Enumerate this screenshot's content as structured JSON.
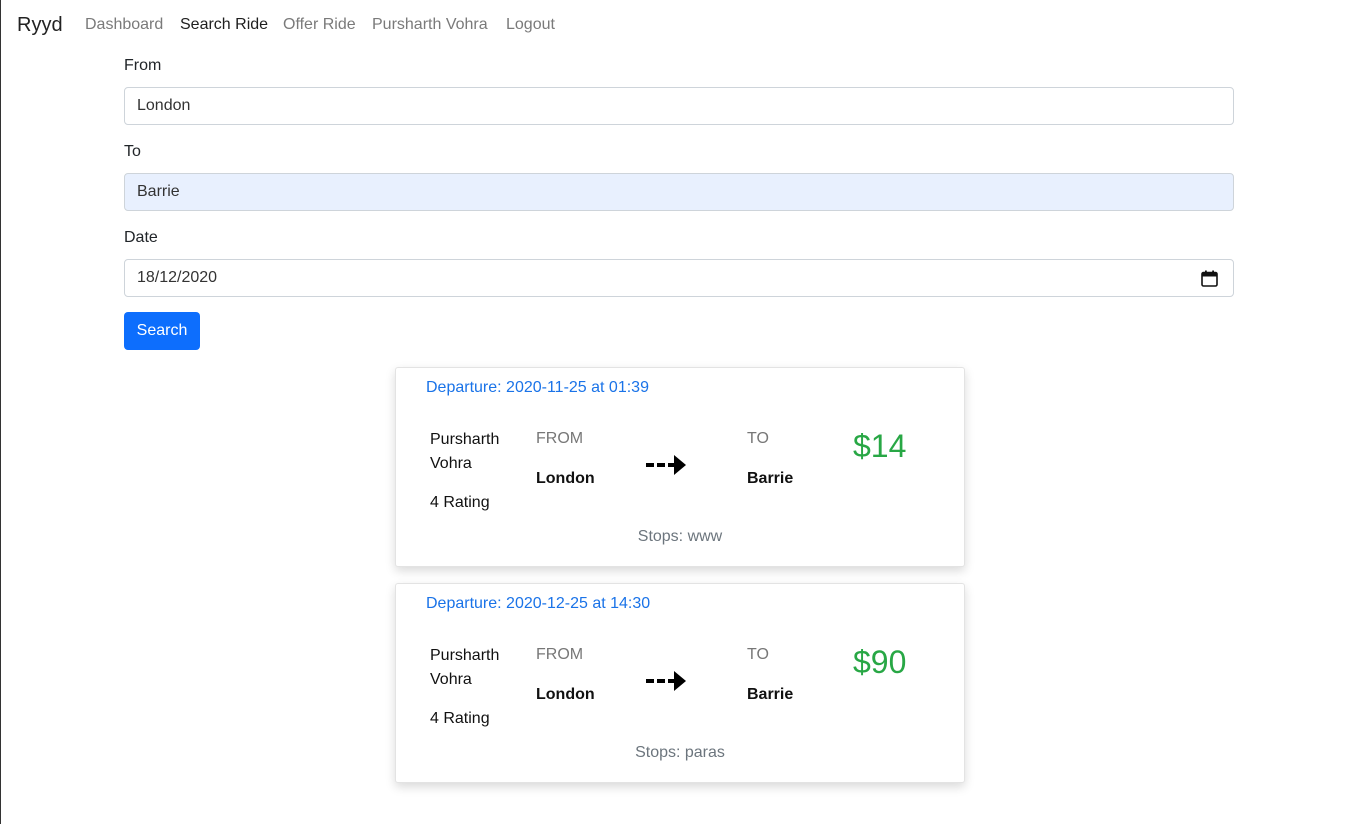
{
  "nav": {
    "brand": "Ryyd",
    "links": [
      "Dashboard",
      "Search Ride",
      "Offer Ride",
      "Pursharth Vohra",
      "Logout"
    ]
  },
  "form": {
    "from_label": "From",
    "from_value": "London",
    "to_label": "To",
    "to_value": "Barrie",
    "date_label": "Date",
    "date_value": "18/12/2020",
    "search_button": "Search"
  },
  "results": [
    {
      "departure": "Departure: 2020-11-25 at 01:39",
      "driver": "Pursharth Vohra",
      "rating": "4 Rating",
      "from_caption": "FROM",
      "from_city": "London",
      "to_caption": "TO",
      "to_city": "Barrie",
      "price": "$14",
      "stops": "Stops: www"
    },
    {
      "departure": "Departure: 2020-12-25 at 14:30",
      "driver": "Pursharth Vohra",
      "rating": "4 Rating",
      "from_caption": "FROM",
      "from_city": "London",
      "to_caption": "TO",
      "to_city": "Barrie",
      "price": "$90",
      "stops": "Stops: paras"
    }
  ],
  "colors": {
    "primary": "#0d6efd",
    "price_green": "#28a745",
    "departure_blue": "#1a73e8",
    "autofill_bg": "#e8f0fe"
  },
  "icons": [
    "calendar-icon",
    "dashed-arrow-icon"
  ]
}
